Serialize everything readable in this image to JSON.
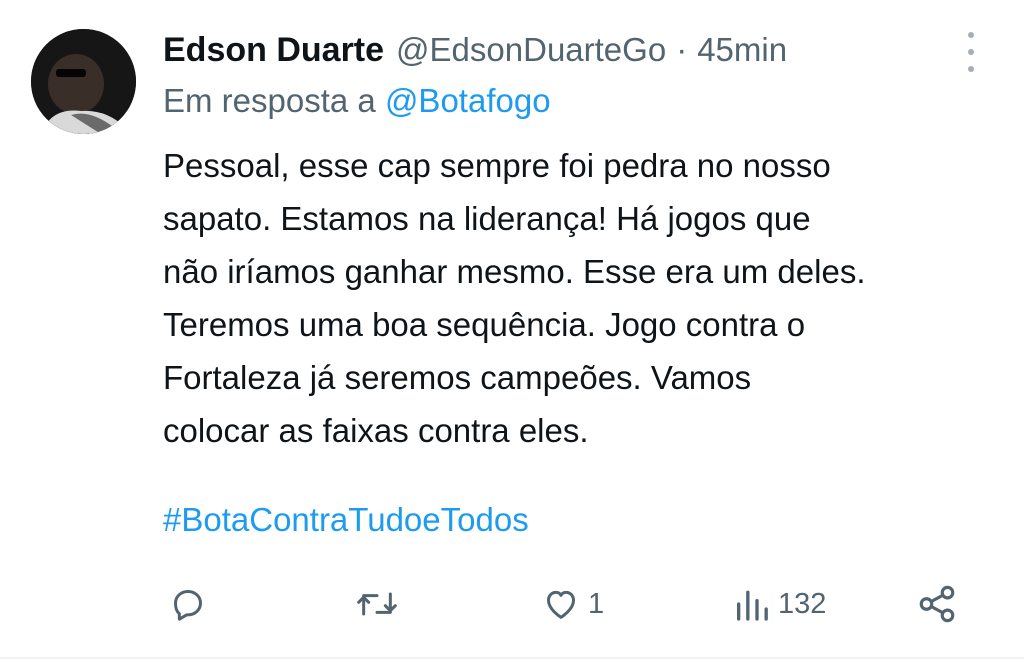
{
  "tweet": {
    "author_name": "Edson Duarte",
    "author_handle": "@EdsonDuarteGo",
    "separator": "·",
    "time": "45min",
    "reply_prefix": "Em resposta a",
    "reply_mention": "@Botafogo",
    "body_lines": [
      "Pessoal, esse cap sempre foi pedra no nosso",
      "sapato. Estamos na liderança! Há jogos que",
      "não iríamos ganhar mesmo. Esse era um deles.",
      "Teremos uma boa sequência. Jogo contra o",
      "Fortaleza já seremos campeões. Vamos",
      "colocar as faixas contra eles."
    ],
    "hashtag": "#BotaContraTudoeTodos"
  },
  "actions": {
    "reply": {
      "icon": "reply-icon"
    },
    "retweet": {
      "icon": "retweet-icon"
    },
    "like": {
      "icon": "heart-icon",
      "count": "1"
    },
    "views": {
      "icon": "views-icon",
      "count": "132"
    },
    "share": {
      "icon": "share-icon"
    }
  },
  "colors": {
    "text": "#0f1419",
    "secondary": "#536471",
    "link": "#1d9bf0",
    "background": "#ffffff"
  }
}
